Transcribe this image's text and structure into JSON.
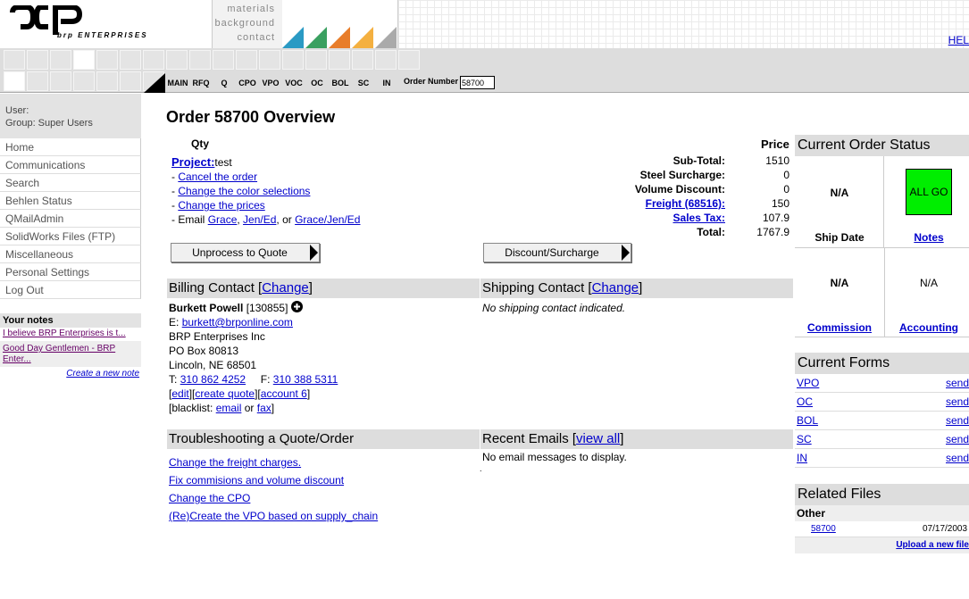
{
  "brand": {
    "mark": "ↄᴅᴘ",
    "sub": "brp ENTERPRISES"
  },
  "topnav": [
    "materials",
    "background",
    "contact"
  ],
  "help": "HEL",
  "triangle_colors": [
    "#2a9ac4",
    "#3aa060",
    "#e87d2a",
    "#f4b040",
    "#aaaaaa"
  ],
  "toolbar": {
    "buttons": [
      "MAIN",
      "RFQ",
      "Q",
      "CPO",
      "VPO",
      "VOC",
      "OC",
      "BOL",
      "SC",
      "IN"
    ],
    "order_number_label": "Order Number",
    "order_number_value": "58700"
  },
  "sidebar": {
    "user_label": "User:",
    "group_label": "Group: Super Users",
    "items": [
      "Home",
      "Communications",
      "Search",
      "Behlen Status",
      "QMailAdmin",
      "SolidWorks Files (FTP)",
      "Miscellaneous",
      "Personal Settings",
      "Log Out"
    ],
    "notes_title": "Your notes",
    "notes": [
      "I believe BRP Enterprises is t...",
      "Good Day Gentlemen - BRP Enter..."
    ],
    "new_note": "Create a new note"
  },
  "main": {
    "title": "Order 58700 Overview",
    "qty_label": "Qty",
    "price_label": "Price",
    "project_label": "Project:",
    "project_value": "test",
    "actions": [
      "Cancel the order",
      "Change the color selections",
      "Change the prices"
    ],
    "email_prefix": "- Email",
    "email_grace": "Grace",
    "email_jened": "Jen/Ed",
    "email_or": ", or",
    "email_all": "Grace/Jen/Ed",
    "summary": [
      {
        "label": "Sub-Total:",
        "value": "1510",
        "link": false
      },
      {
        "label": "Steel Surcharge:",
        "value": "0",
        "link": false
      },
      {
        "label": "Volume Discount:",
        "value": "0",
        "link": false
      },
      {
        "label": "Freight (68516):",
        "value": "150",
        "link": true
      },
      {
        "label": "Sales Tax:",
        "value": "107.9",
        "link": true
      },
      {
        "label": "Total:",
        "value": "1767.9",
        "link": false
      }
    ],
    "btn_unprocess": "Unprocess to Quote",
    "btn_discount": "Discount/Surcharge",
    "billing": {
      "title": "Billing Contact [",
      "change": "Change",
      "close": "]",
      "name": "Burkett Powell",
      "id": "[130855]",
      "email_label": "E:",
      "email": "burkett@brponline.com",
      "company": "BRP Enterprises Inc",
      "box": "PO Box 80813",
      "city": "Lincoln, NE 68501",
      "t_label": "T:",
      "phone": "310 862 4252",
      "f_label": "F:",
      "fax": "310 388 5311",
      "edit": "edit",
      "create_quote": "create quote",
      "account": "account 6",
      "blacklist_label": "[blacklist:",
      "bl_email": "email",
      "bl_or": "or",
      "bl_fax": "fax",
      "bl_close": "]"
    },
    "shipping": {
      "title": "Shipping Contact [",
      "change": "Change",
      "close": "]",
      "none": "No shipping contact indicated."
    },
    "troubleshoot": {
      "title": "Troubleshooting a Quote/Order",
      "links": [
        "Change the freight charges.",
        "Fix commisions and volume discount",
        "Change the CPO",
        "(Re)Create the VPO based on supply_chain"
      ]
    },
    "emails": {
      "title": "Recent Emails [",
      "view_all": "view all",
      "close": "]",
      "none": "No email messages to display.",
      "dot": "."
    }
  },
  "status": {
    "title": "Current Order Status",
    "ship_date_val": "N/A",
    "all_go": "ALL GO",
    "ship_date": "Ship Date",
    "notes": "Notes",
    "commission_val": "N/A",
    "accounting_val": "N/A",
    "commission": "Commission",
    "accounting": "Accounting",
    "all_go_color": "#00ee00"
  },
  "forms": {
    "title": "Current Forms",
    "rows": [
      {
        "name": "VPO",
        "action": "send"
      },
      {
        "name": "OC",
        "action": "send"
      },
      {
        "name": "BOL",
        "action": "send"
      },
      {
        "name": "SC",
        "action": "send"
      },
      {
        "name": "IN",
        "action": "send"
      }
    ]
  },
  "files": {
    "title": "Related Files",
    "other": "Other",
    "file": "58700",
    "date": "07/17/2003",
    "upload": "Upload a new file"
  }
}
